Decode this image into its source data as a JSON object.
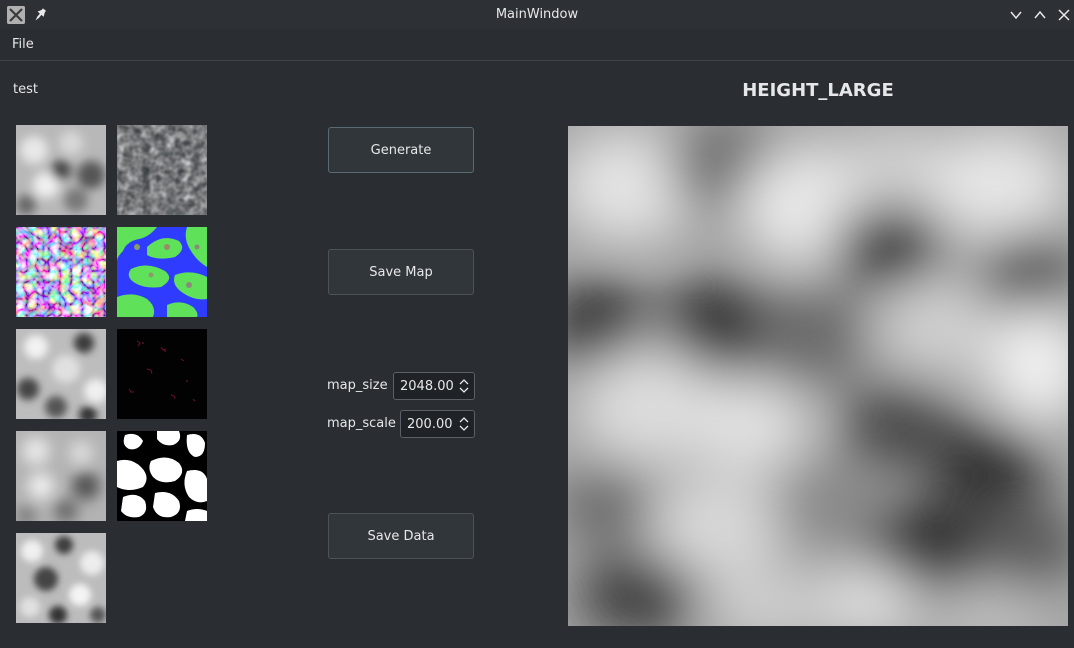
{
  "window": {
    "title": "MainWindow"
  },
  "menubar": {
    "items": [
      "File"
    ]
  },
  "left_panel": {
    "label": "test",
    "thumbnails": [
      {
        "icon": "height-map-thumbnail"
      },
      {
        "icon": "noise-thumbnail"
      },
      {
        "icon": "normal-map-thumbnail"
      },
      {
        "icon": "terrain-color-thumbnail"
      },
      {
        "icon": "height-map-thumbnail-2"
      },
      {
        "icon": "dark-mask-thumbnail"
      },
      {
        "icon": "height-map-blurred-thumbnail"
      },
      {
        "icon": "binary-mask-thumbnail"
      },
      {
        "icon": "height-map-thumbnail-3"
      }
    ]
  },
  "controls": {
    "generate_label": "Generate",
    "save_map_label": "Save Map",
    "save_data_label": "Save Data",
    "map_size": {
      "label": "map_size",
      "value": "2048.00"
    },
    "map_scale": {
      "label": "map_scale",
      "value": "200.00"
    }
  },
  "preview": {
    "title": "HEIGHT_LARGE"
  },
  "colors": {
    "background": "#2a2e32",
    "button": "#31363b",
    "text": "#e6e7e8",
    "water": "#2f3cff",
    "land": "#5fe25a"
  }
}
